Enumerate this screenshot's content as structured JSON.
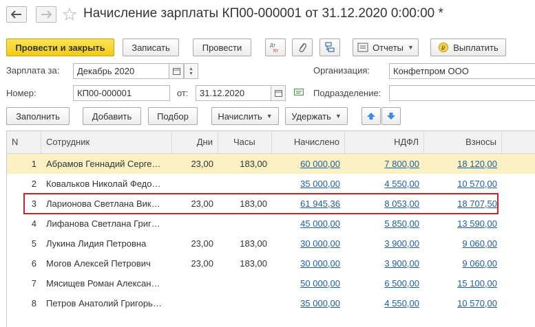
{
  "window": {
    "title": "Начисление зарплаты КП00-000001 от 31.12.2020 0:00:00 *"
  },
  "toolbar": {
    "post_close": "Провести и закрыть",
    "save": "Записать",
    "post": "Провести",
    "reports": "Отчеты",
    "pay": "Выплатить"
  },
  "form": {
    "salary_for_label": "Зарплата за:",
    "salary_for_value": "Декабрь 2020",
    "number_label": "Номер:",
    "number_value": "КП00-000001",
    "from_label": "от:",
    "date_value": "31.12.2020",
    "org_label": "Организация:",
    "org_value": "Конфетпром ООО",
    "division_label": "Подразделение:",
    "division_value": ""
  },
  "table_toolbar": {
    "fill": "Заполнить",
    "add": "Добавить",
    "pick": "Подбор",
    "accrue": "Начислить",
    "withhold": "Удержать"
  },
  "table": {
    "headers": {
      "n": "N",
      "employee": "Сотрудник",
      "days": "Дни",
      "hours": "Часы",
      "accrued": "Начислено",
      "ndfl": "НДФЛ",
      "contrib": "Взносы"
    },
    "rows": [
      {
        "n": "1",
        "employee": "Абрамов Геннадий Серге…",
        "days": "23,00",
        "hours": "183,00",
        "accrued": "60 000,00",
        "ndfl": "7 800,00",
        "contrib": "18 120,00"
      },
      {
        "n": "2",
        "employee": "Ковальков Николай Федо…",
        "days": "",
        "hours": "",
        "accrued": "35 000,00",
        "ndfl": "4 550,00",
        "contrib": "10 570,00"
      },
      {
        "n": "3",
        "employee": "Ларионова Светлана Вик…",
        "days": "23,00",
        "hours": "183,00",
        "accrued": "61 945,36",
        "ndfl": "8 053,00",
        "contrib": "18 707,50"
      },
      {
        "n": "4",
        "employee": "Лифанова Светлана Григ…",
        "days": "",
        "hours": "",
        "accrued": "45 000,00",
        "ndfl": "5 850,00",
        "contrib": "13 590,00"
      },
      {
        "n": "5",
        "employee": "Лукина Лидия Петровна",
        "days": "23,00",
        "hours": "183,00",
        "accrued": "30 000,00",
        "ndfl": "3 900,00",
        "contrib": "9 060,00"
      },
      {
        "n": "6",
        "employee": "Могов Алексей Петрович",
        "days": "23,00",
        "hours": "183,00",
        "accrued": "30 000,00",
        "ndfl": "3 900,00",
        "contrib": "9 060,00"
      },
      {
        "n": "7",
        "employee": "Мясищев Роман Алексан…",
        "days": "",
        "hours": "",
        "accrued": "50 000,00",
        "ndfl": "6 500,00",
        "contrib": "15 100,00"
      },
      {
        "n": "8",
        "employee": "Петров Анатолий Григорь…",
        "days": "",
        "hours": "",
        "accrued": "35 000,00",
        "ndfl": "4 550,00",
        "contrib": "10 570,00"
      }
    ]
  },
  "colors": {
    "primary_button": "#f2cb12",
    "selected_row": "#fcf1c3",
    "link": "#1a5ea8",
    "highlight": "#d21f26"
  }
}
